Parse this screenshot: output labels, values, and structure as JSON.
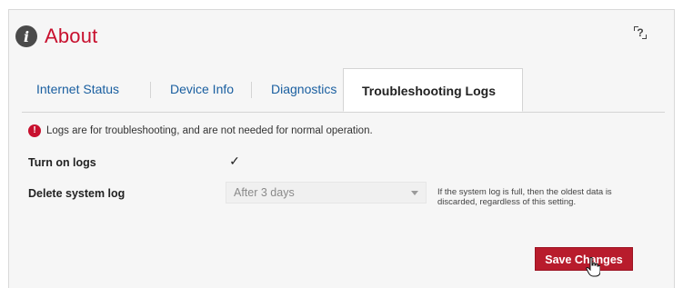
{
  "header": {
    "title": "About",
    "info_icon": "info-icon",
    "help_icon": "help-icon",
    "help_glyph": "?"
  },
  "tabs": [
    {
      "label": "Internet Status",
      "active": false
    },
    {
      "label": "Device Info",
      "active": false
    },
    {
      "label": "Diagnostics",
      "active": false
    },
    {
      "label": "Troubleshooting Logs",
      "active": true
    }
  ],
  "notice": {
    "icon": "alert-icon",
    "icon_glyph": "!",
    "text": "Logs are for troubleshooting, and are not needed for normal operation."
  },
  "settings": {
    "turn_on_logs": {
      "label": "Turn on logs",
      "checked": true,
      "check_glyph": "✓"
    },
    "delete_log": {
      "label": "Delete system log",
      "selected": "After 3 days",
      "hint": "If the system log is full, then the oldest data is discarded, regardless of this setting."
    }
  },
  "actions": {
    "save_label": "Save Changes"
  },
  "colors": {
    "brand_red": "#c8102e",
    "link_blue": "#1a5fa0",
    "button_red": "#b81c2c"
  }
}
